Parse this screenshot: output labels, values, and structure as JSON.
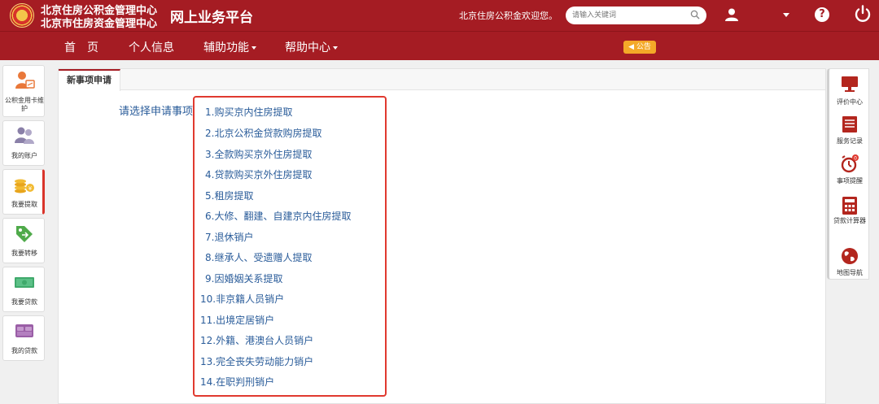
{
  "header": {
    "org_line1": "北京住房公积金管理中心",
    "org_line2": "北京市住房资金管理中心",
    "platform_title": "网上业务平台",
    "welcome": "北京住房公积金欢迎您。",
    "search_placeholder": "请输入关键词",
    "help_glyph": "?"
  },
  "nav": {
    "items": [
      {
        "label": "首　页"
      },
      {
        "label": "个人信息"
      },
      {
        "label": "辅助功能"
      },
      {
        "label": "帮助中心"
      }
    ],
    "notice": "◀ 公告"
  },
  "left_sidebar": {
    "items": [
      {
        "label": "公积金用卡维护",
        "icon": "person-card-icon"
      },
      {
        "label": "我的账户",
        "icon": "users-icon"
      },
      {
        "label": "我要提取",
        "icon": "coins-icon"
      },
      {
        "label": "我要转移",
        "icon": "transfer-tag-icon"
      },
      {
        "label": "我要贷款",
        "icon": "cash-icon"
      },
      {
        "label": "我的贷款",
        "icon": "bed-icon"
      }
    ]
  },
  "main": {
    "tab_label": "新事项申请",
    "prompt": "请选择申请事项：",
    "options": [
      "1.购买京内住房提取",
      "2.北京公积金贷款购房提取",
      "3.全款购买京外住房提取",
      "4.贷款购买京外住房提取",
      "5.租房提取",
      "6.大修、翻建、自建京内住房提取",
      "7.退休销户",
      "8.继承人、受遗赠人提取",
      "9.因婚姻关系提取",
      "10.非京籍人员销户",
      "11.出境定居销户",
      "12.外籍、港澳台人员销户",
      "13.完全丧失劳动能力销户",
      "14.在职判刑销户"
    ]
  },
  "right_sidebar": {
    "items": [
      {
        "label": "评价中心",
        "icon": "monitor-icon"
      },
      {
        "label": "服务记录",
        "icon": "document-icon"
      },
      {
        "label": "事项提醒",
        "icon": "alarm-clock-icon",
        "badge": "0"
      },
      {
        "label": "贷款计算器",
        "icon": "calculator-icon"
      },
      {
        "label": "地图导航",
        "icon": "globe-icon"
      }
    ]
  },
  "colors": {
    "brand_red": "#a51c23",
    "highlight_red": "#e0392f",
    "link_blue": "#2a5c9a",
    "notice_orange": "#f4a928"
  }
}
